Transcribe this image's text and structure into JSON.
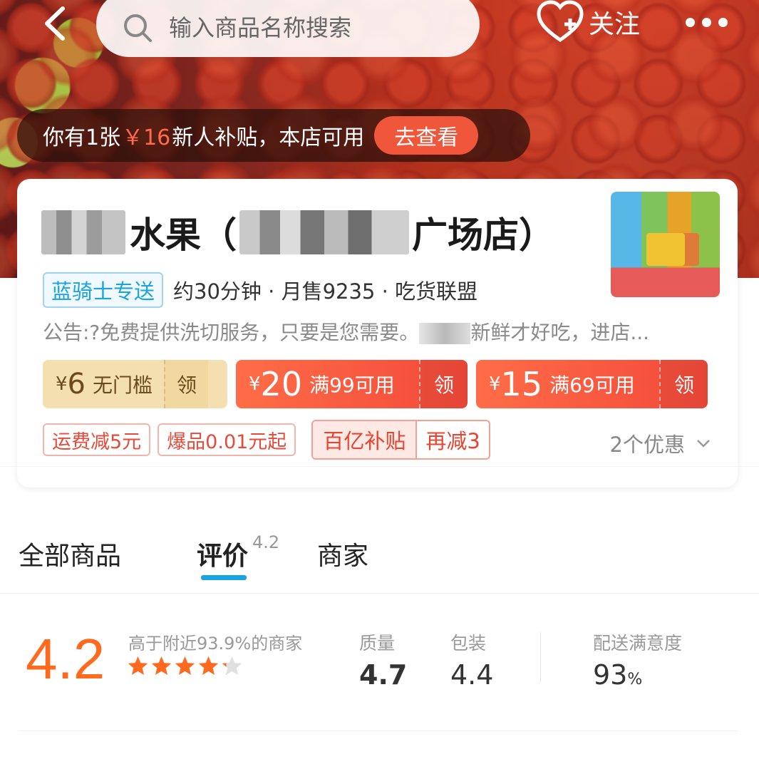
{
  "header": {
    "search_placeholder": "输入商品名称搜索",
    "follow_label": "关注"
  },
  "subsidy": {
    "prefix": "你有1张",
    "amount": "￥16",
    "suffix": "新人补贴，本店可用",
    "button": "去查看"
  },
  "shop": {
    "name_part1": "水果（",
    "name_part2": "广场店）",
    "delivery_tag": "蓝骑士专送",
    "meta": "约30分钟 · 月售9235 · 吃货联盟",
    "notice_part1": "公告:?免费提供洗切服务，只要是您需要。",
    "notice_part2": "新鲜才好吃，进店..."
  },
  "coupons": [
    {
      "yen": "¥",
      "value": "6",
      "desc": "无门槛",
      "action": "领"
    },
    {
      "yen": "¥",
      "value": "20",
      "desc": "满99可用",
      "action": "领"
    },
    {
      "yen": "¥",
      "value": "15",
      "desc": "满69可用",
      "action": "领"
    }
  ],
  "promos": {
    "shipping": "运费减5元",
    "hot": "爆品0.01元起",
    "combo_left": "百亿补贴",
    "combo_right": "再减3",
    "offers_count": "2个优惠"
  },
  "tabs": {
    "all_goods": "全部商品",
    "reviews": "评价",
    "reviews_score": "4.2",
    "merchant": "商家"
  },
  "rating": {
    "score": "4.2",
    "comparison": "高于附近93.9%的商家",
    "stars": 4.2,
    "quality_label": "质量",
    "quality_value": "4.7",
    "package_label": "包装",
    "package_value": "4.4",
    "delivery_label": "配送满意度",
    "delivery_value": "93",
    "delivery_unit": "%"
  },
  "colors": {
    "accent_orange": "#ff6a1f",
    "brand_blue": "#19a3e0",
    "coupon_red": "#f2493a",
    "coupon_gold": "#f4dfb0"
  }
}
